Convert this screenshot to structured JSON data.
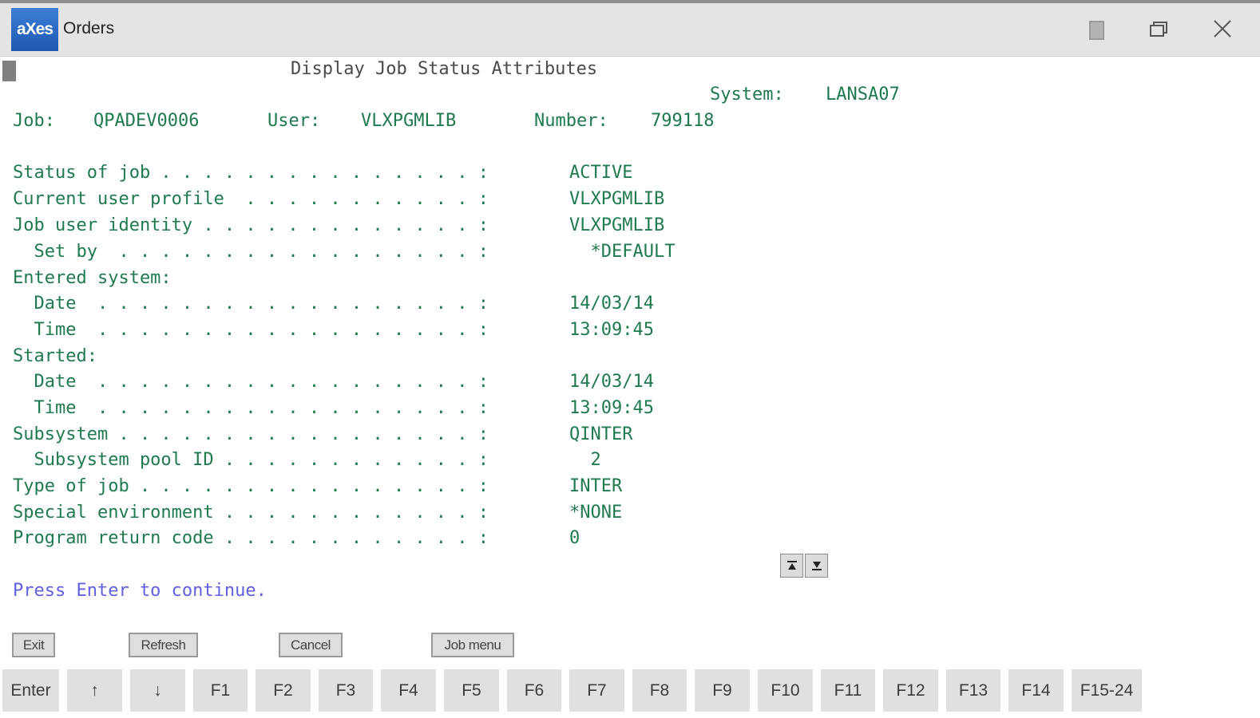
{
  "window": {
    "logo_text": "aXes",
    "title": "Orders",
    "colors": {
      "titlebar": "#e4e4e4",
      "logo": "#1d58b2",
      "terminal_text": "#1f7a4f",
      "message_text": "#6060e0"
    }
  },
  "screen": {
    "title": "Display Job Status Attributes",
    "system_label": "System:",
    "system_value": "LANSA07",
    "job_label": "Job:",
    "job_value": "QPADEV0006",
    "user_label": "User:",
    "user_value": "VLXPGMLIB",
    "number_label": "Number:",
    "number_value": "799118",
    "fields": [
      {
        "label": "Status of job . . . . . . . . . . . . . . . :",
        "value": "ACTIVE"
      },
      {
        "label": "Current user profile  . . . . . . . . . . . :",
        "value": "VLXPGMLIB"
      },
      {
        "label": "Job user identity . . . . . . . . . . . . . :",
        "value": "VLXPGMLIB"
      },
      {
        "label": "  Set by  . . . . . . . . . . . . . . . . . :",
        "value": "  *DEFAULT"
      },
      {
        "label": "Entered system:",
        "value": ""
      },
      {
        "label": "  Date  . . . . . . . . . . . . . . . . . . :",
        "value": "14/03/14"
      },
      {
        "label": "  Time  . . . . . . . . . . . . . . . . . . :",
        "value": "13:09:45"
      },
      {
        "label": "Started:",
        "value": ""
      },
      {
        "label": "  Date  . . . . . . . . . . . . . . . . . . :",
        "value": "14/03/14"
      },
      {
        "label": "  Time  . . . . . . . . . . . . . . . . . . :",
        "value": "13:09:45"
      },
      {
        "label": "Subsystem . . . . . . . . . . . . . . . . . :",
        "value": "QINTER"
      },
      {
        "label": "  Subsystem pool ID . . . . . . . . . . . . :",
        "value": "  2"
      },
      {
        "label": "Type of job . . . . . . . . . . . . . . . . :",
        "value": "INTER"
      },
      {
        "label": "Special environment . . . . . . . . . . . . :",
        "value": "*NONE"
      },
      {
        "label": "Program return code . . . . . . . . . . . . :",
        "value": "0"
      }
    ],
    "message": "Press Enter to continue.",
    "scroll": {
      "top_icon": "scroll-top-icon",
      "bottom_icon": "scroll-bottom-icon"
    }
  },
  "commands": [
    {
      "id": "exit",
      "label": "Exit"
    },
    {
      "id": "refresh",
      "label": "Refresh"
    },
    {
      "id": "cancel",
      "label": "Cancel"
    },
    {
      "id": "job-menu",
      "label": "Job menu"
    }
  ],
  "function_keys": [
    {
      "id": "enter",
      "label": "Enter"
    },
    {
      "id": "up",
      "label": "↑"
    },
    {
      "id": "down",
      "label": "↓"
    },
    {
      "id": "f1",
      "label": "F1"
    },
    {
      "id": "f2",
      "label": "F2"
    },
    {
      "id": "f3",
      "label": "F3"
    },
    {
      "id": "f4",
      "label": "F4"
    },
    {
      "id": "f5",
      "label": "F5"
    },
    {
      "id": "f6",
      "label": "F6"
    },
    {
      "id": "f7",
      "label": "F7"
    },
    {
      "id": "f8",
      "label": "F8"
    },
    {
      "id": "f9",
      "label": "F9"
    },
    {
      "id": "f10",
      "label": "F10"
    },
    {
      "id": "f11",
      "label": "F11"
    },
    {
      "id": "f12",
      "label": "F12"
    },
    {
      "id": "f13",
      "label": "F13"
    },
    {
      "id": "f14",
      "label": "F14"
    },
    {
      "id": "f15-24",
      "label": "F15-24"
    }
  ]
}
